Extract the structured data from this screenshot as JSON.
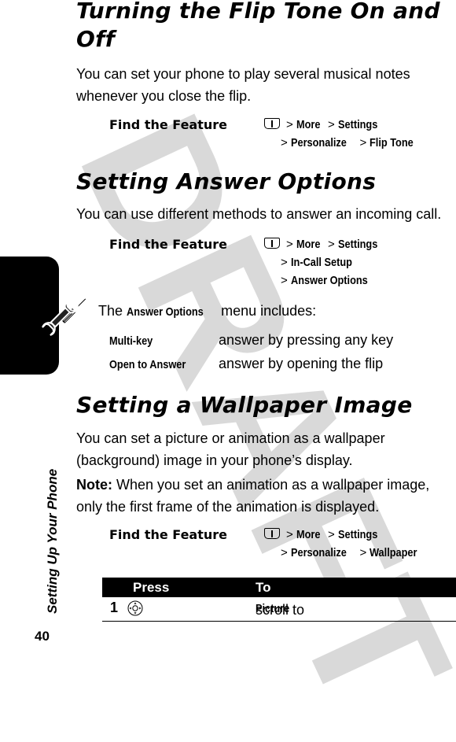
{
  "watermark": "DRAFT",
  "sidebar": {
    "section_title": "Setting Up Your Phone",
    "page_number": "40",
    "icon": "tools-icon"
  },
  "sections": [
    {
      "title": "Turning the Flip Tone On and Off",
      "body": "You can set your phone to play several musical notes whenever you close the flip.",
      "find_feature": {
        "label": "Find the Feature",
        "icon": "menu-key-icon",
        "path_lines": [
          [
            "More",
            "Settings"
          ],
          [
            "Personalize",
            "Flip Tone"
          ]
        ]
      }
    },
    {
      "title": "Setting Answer Options",
      "body": "You can use different methods to answer an incoming call.",
      "find_feature": {
        "label": "Find the Feature",
        "icon": "menu-key-icon",
        "path_lines": [
          [
            "More",
            "Settings"
          ],
          [
            "In-Call Setup"
          ],
          [
            "Answer Options"
          ]
        ]
      },
      "menu_intro": {
        "prefix": "The",
        "keyword": "Answer Options",
        "suffix": "menu includes:"
      },
      "options": [
        {
          "name": "Multi-key",
          "description": "answer by pressing any key"
        },
        {
          "name": "Open to Answer",
          "description": "answer by opening the flip"
        }
      ]
    },
    {
      "title": "Setting a Wallpaper Image",
      "body": "You can set a picture or animation as a wallpaper (background) image in your phone’s display.",
      "note_label": "Note:",
      "note_text": "When you set an animation as a wallpaper image, only the first frame of the animation is displayed.",
      "find_feature": {
        "label": "Find the Feature",
        "icon": "menu-key-icon",
        "path_lines": [
          [
            "More",
            "Settings"
          ],
          [
            "Personalize",
            "Wallpaper"
          ]
        ]
      },
      "table": {
        "headers": [
          "Press",
          "To"
        ],
        "rows": [
          {
            "step": "1",
            "press_icon": "nav-key-icon",
            "to_prefix": "scroll to",
            "to_keyword": "Picture"
          }
        ]
      }
    }
  ]
}
